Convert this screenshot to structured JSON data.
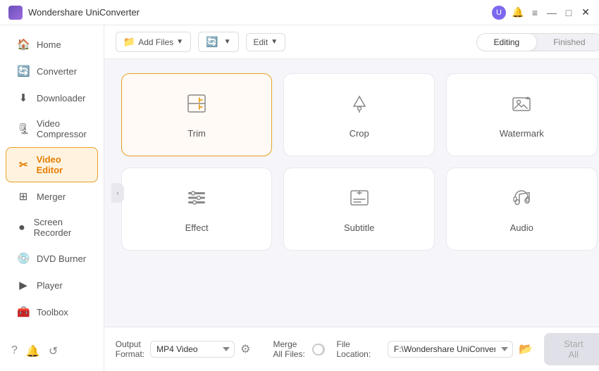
{
  "app": {
    "title": "Wondershare UniConverter"
  },
  "titlebar": {
    "min_label": "—",
    "max_label": "□",
    "close_label": "✕"
  },
  "sidebar": {
    "items": [
      {
        "id": "home",
        "icon": "🏠",
        "label": "Home"
      },
      {
        "id": "converter",
        "icon": "🔄",
        "label": "Converter"
      },
      {
        "id": "downloader",
        "icon": "⬇",
        "label": "Downloader"
      },
      {
        "id": "video-compressor",
        "icon": "🗜",
        "label": "Video Compressor"
      },
      {
        "id": "video-editor",
        "icon": "✂",
        "label": "Video Editor"
      },
      {
        "id": "merger",
        "icon": "⊞",
        "label": "Merger"
      },
      {
        "id": "screen-recorder",
        "icon": "⏺",
        "label": "Screen Recorder"
      },
      {
        "id": "dvd-burner",
        "icon": "💿",
        "label": "DVD Burner"
      },
      {
        "id": "player",
        "icon": "▶",
        "label": "Player"
      },
      {
        "id": "toolbox",
        "icon": "🧰",
        "label": "Toolbox"
      }
    ],
    "active": "video-editor",
    "bottom_icons": [
      "?",
      "🔔",
      "↺"
    ]
  },
  "toolbar": {
    "add_file_label": "Add Files",
    "add_file_icon": "📁",
    "add_convert_label": "Add Convert",
    "edit_label": "Edit",
    "tabs": [
      {
        "id": "editing",
        "label": "Editing"
      },
      {
        "id": "finished",
        "label": "Finished"
      }
    ],
    "active_tab": "editing"
  },
  "features": [
    {
      "id": "trim",
      "icon": "✂",
      "label": "Trim",
      "active": true
    },
    {
      "id": "crop",
      "icon": "⊡",
      "label": "Crop",
      "active": false
    },
    {
      "id": "watermark",
      "icon": "📷",
      "label": "Watermark",
      "active": false
    },
    {
      "id": "effect",
      "icon": "☰",
      "label": "Effect",
      "active": false
    },
    {
      "id": "subtitle",
      "icon": "⊕",
      "label": "Subtitle",
      "active": false
    },
    {
      "id": "audio",
      "icon": "🎧",
      "label": "Audio",
      "active": false
    }
  ],
  "bottom": {
    "output_format_label": "Output Format:",
    "output_format_value": "MP4 Video",
    "file_location_label": "File Location:",
    "file_location_value": "F:\\Wondershare UniConverter",
    "merge_all_label": "Merge All Files:",
    "start_all_label": "Start All"
  }
}
